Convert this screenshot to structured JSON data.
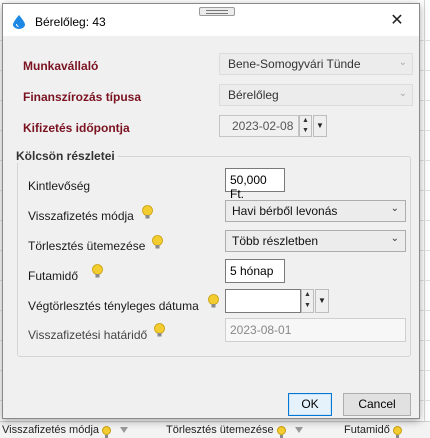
{
  "window": {
    "title": "Bérelőleg: 43",
    "close_glyph": "✕"
  },
  "header_fields": {
    "employee_label": "Munkavállaló",
    "employee_value": "Bene-Somogyvári Tünde",
    "financing_label": "Finanszírozás típusa",
    "financing_value": "Bérelőleg",
    "payout_label": "Kifizetés időpontja",
    "payout_date": "2023-02-08"
  },
  "loan": {
    "group_title": "Kölcsön részletei",
    "outstanding_label": "Kintlevőség",
    "outstanding_value": "50,000 Ft.",
    "repayment_method_label": "Visszafizetés módja",
    "repayment_method_value": "Havi bérből levonás",
    "schedule_label": "Törlesztés ütemezése",
    "schedule_value": "Több részletben",
    "term_label": "Futamidő",
    "term_value": "5 hónap",
    "final_date_label": "Végtörlesztés tényleges dátuma",
    "final_date_value": "",
    "deadline_label": "Visszafizetési határidő",
    "deadline_value": "2023-08-01"
  },
  "buttons": {
    "ok": "OK",
    "cancel": "Cancel"
  },
  "background_footer": {
    "col1": "Visszafizetés módja",
    "col2": "Törlesztés ütemezése",
    "col3": "Futamidő"
  },
  "icons": {
    "app": "water-drop-icon",
    "hint": "lightbulb-icon",
    "dropdown": "chevron-down-icon",
    "spinner": "spin-arrows-icon",
    "filter": "funnel-icon"
  },
  "colors": {
    "required_label": "#7a1220",
    "primary_border": "#0078d7",
    "app_icon": "#1e88e5",
    "hint_bulb": "#f3cc30"
  }
}
